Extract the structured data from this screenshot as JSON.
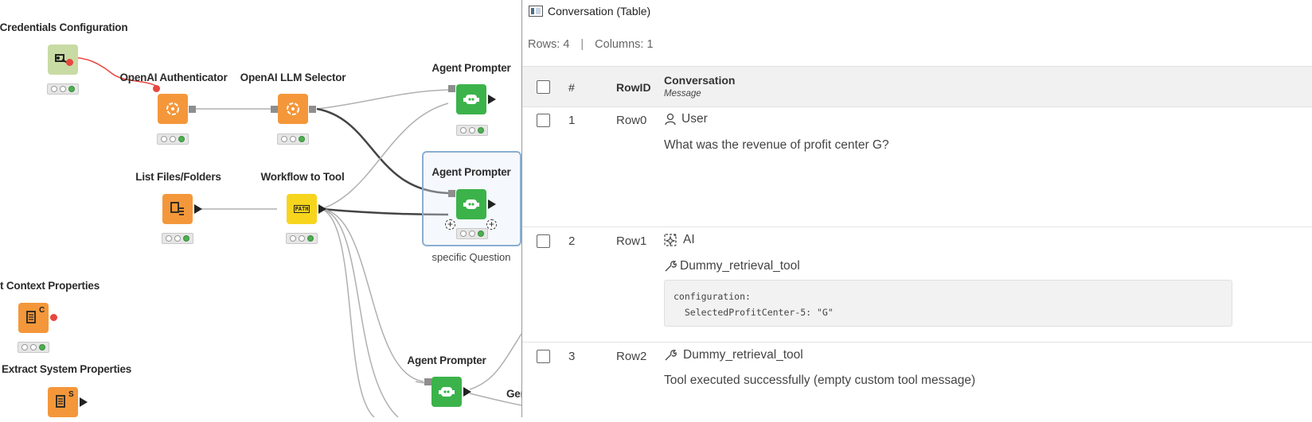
{
  "workflow": {
    "nodes": {
      "credentials_config": {
        "title": "Credentials Configuration"
      },
      "openai_auth": {
        "title": "OpenAI Authenticator"
      },
      "llm_selector": {
        "title": "OpenAI LLM Selector"
      },
      "agent_prompter_1": {
        "title": "Agent Prompter"
      },
      "list_files": {
        "title": "List Files/Folders"
      },
      "workflow_to_tool": {
        "title": "Workflow to Tool",
        "icon_text": "PATH"
      },
      "agent_prompter_2": {
        "title": "Agent Prompter",
        "subtitle": "specific Question"
      },
      "context_props": {
        "title": "t Context Properties",
        "icon_letter": "C"
      },
      "system_props": {
        "title": "Extract System Properties",
        "icon_letter": "S"
      },
      "agent_prompter_3": {
        "title": "Agent Prompter"
      },
      "partial_node": {
        "title": "Ger"
      }
    }
  },
  "table_view": {
    "title": "Conversation (Table)",
    "rows_label": "Rows: 4",
    "separator": "|",
    "columns_label": "Columns: 1",
    "headers": {
      "index": "#",
      "rowid": "RowID",
      "conversation": "Conversation",
      "conversation_type": "Message"
    },
    "rows": [
      {
        "index": "1",
        "rowid": "Row0",
        "role": "User",
        "role_icon": "user-icon",
        "text": "What was the revenue of profit center G?"
      },
      {
        "index": "2",
        "rowid": "Row1",
        "role": "AI",
        "role_icon": "ai-sparkle-icon",
        "tool_call": "Dummy_retrieval_tool",
        "code_line1": "configuration:",
        "code_line2": "  SelectedProfitCenter-5: \"G\""
      },
      {
        "index": "3",
        "rowid": "Row2",
        "role": "Dummy_retrieval_tool",
        "role_icon": "wrench-icon",
        "text": "Tool executed successfully (empty custom tool message)"
      }
    ]
  }
}
